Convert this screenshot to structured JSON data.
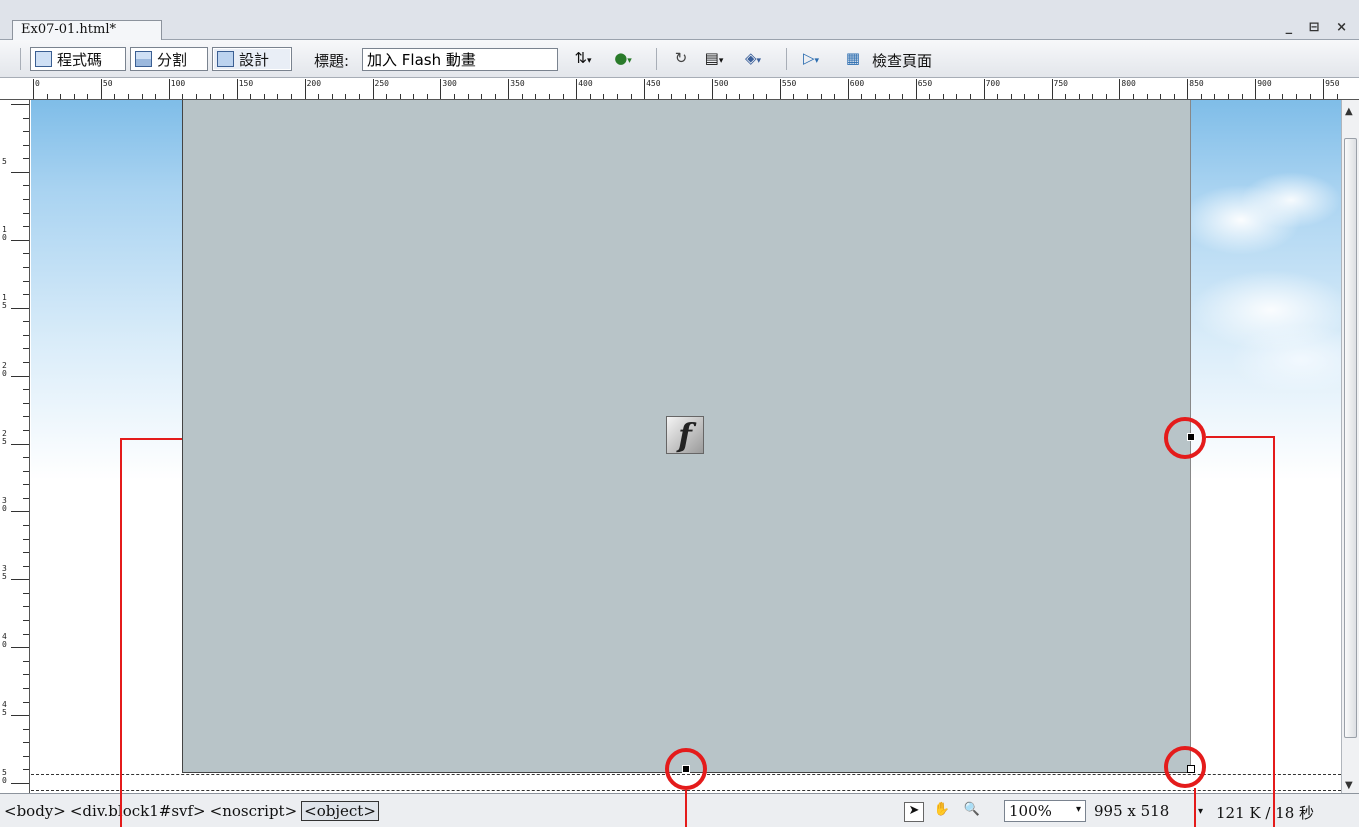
{
  "document_tab": {
    "label": "Ex07-01.html*"
  },
  "window_controls": {
    "label": "_ ⊟ ×"
  },
  "toolbar": {
    "code_button": "程式碼",
    "split_button": "分割",
    "design_button": "設計",
    "title_label": "標題:",
    "title_value": "加入 Flash 動畫",
    "inspect_label": "檢查頁面",
    "icons": [
      "file-management-icon",
      "preview-browser-icon",
      "refresh-icon",
      "view-options-icon",
      "visual-aids-icon",
      "validate-icon",
      "check-compatibility-icon"
    ]
  },
  "ruler": {
    "h_labels": [
      "0",
      "50",
      "100",
      "150",
      "200",
      "250",
      "300",
      "350",
      "400",
      "450",
      "500",
      "550",
      "600",
      "650",
      "700",
      "750",
      "800",
      "850",
      "900",
      "950"
    ],
    "v_labels": [
      "5",
      "10",
      "15",
      "20",
      "25",
      "30",
      "35",
      "40",
      "45",
      "50"
    ]
  },
  "statusbar": {
    "tags": [
      "<body>",
      "<div.block1#svf>",
      "<noscript>",
      "<object>"
    ],
    "zoom": "100%",
    "window_size": "995 x 518",
    "file_size": "121 K / 18 秒"
  },
  "colors": {
    "flash_placeholder": "#b8c4c8",
    "callout": "#e41b1b"
  }
}
